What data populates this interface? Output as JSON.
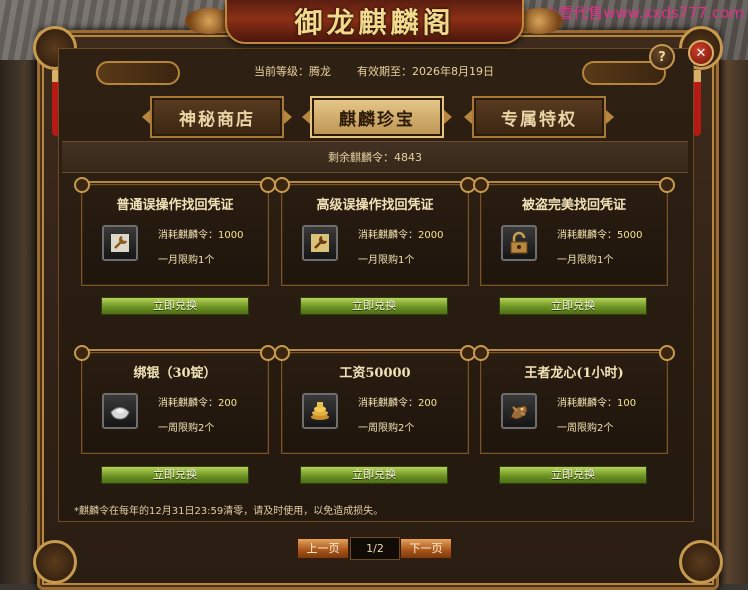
{
  "watermark": "小雪代售www.xxds777.com",
  "window": {
    "title": "御龙麒麟阁",
    "help_glyph": "?",
    "close_glyph": "✕"
  },
  "header": {
    "level_text": "当前等级：腾龙",
    "expiry_text": "有效期至：2026年8月19日"
  },
  "tabs": [
    {
      "label": "神秘商店",
      "active": false
    },
    {
      "label": "麒麟珍宝",
      "active": true
    },
    {
      "label": "专属特权",
      "active": false
    }
  ],
  "remaining": {
    "label": "剩余麒麟令：",
    "value": "4843"
  },
  "cost_label": "消耗麒麟令：",
  "exchange_label": "立即兑换",
  "items": [
    {
      "name": "普通误操作找回凭证",
      "icon": "wrench-key-icon",
      "cost": "1000",
      "limit": "一月限购1个"
    },
    {
      "name": "高级误操作找回凭证",
      "icon": "wrench-key-icon",
      "cost": "2000",
      "limit": "一月限购1个"
    },
    {
      "name": "被盗完美找回凭证",
      "icon": "padlock-icon",
      "cost": "5000",
      "limit": "一月限购1个"
    },
    {
      "name": "绑银（30锭）",
      "icon": "silver-ingot-icon",
      "cost": "200",
      "limit": "一周限购2个"
    },
    {
      "name": "工资50000",
      "icon": "gold-coins-icon",
      "cost": "200",
      "limit": "一周限购2个"
    },
    {
      "name": "王者龙心(1小时)",
      "icon": "dragon-heart-icon",
      "cost": "100",
      "limit": "一周限购2个"
    }
  ],
  "note": "*麒麟令在每年的12月31日23:59清零，请及时使用，以免造成损失。",
  "pagination": {
    "prev": "上一页",
    "indicator": "1/2",
    "next": "下一页"
  },
  "colors": {
    "frame_gold": "#b8873f",
    "exchange_green": "#6e9424",
    "page_orange": "#a8541a",
    "watermark_pink": "#e0308a"
  }
}
